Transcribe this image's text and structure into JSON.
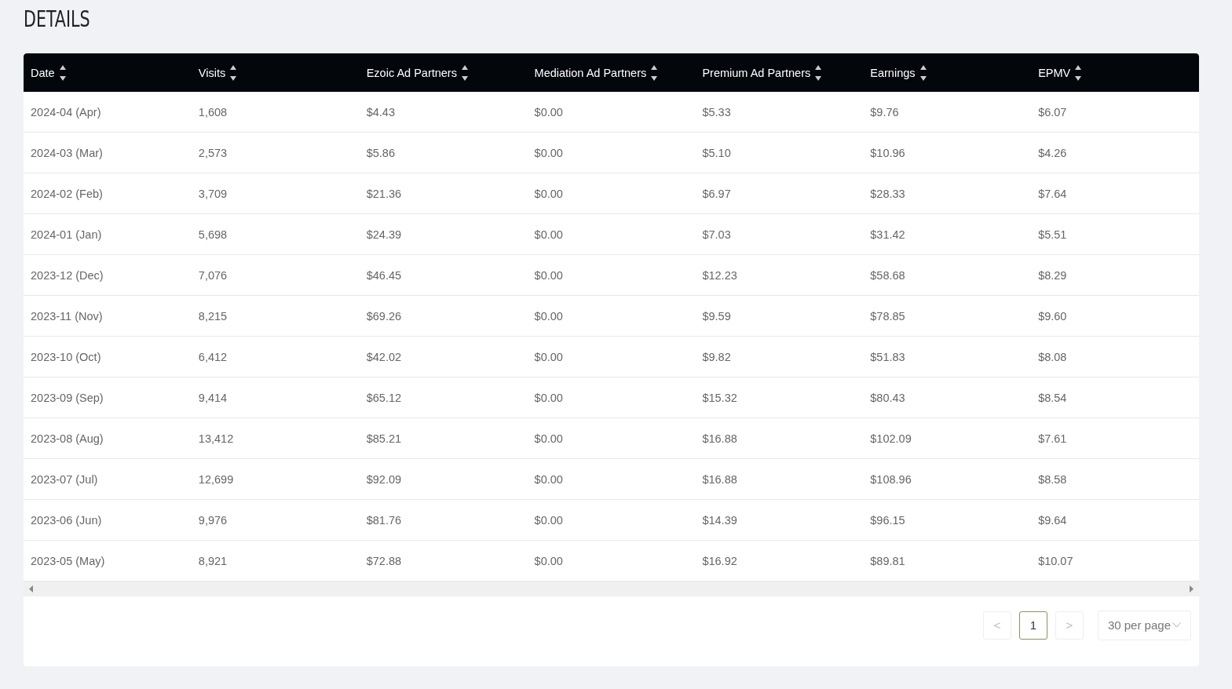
{
  "title": "DETAILS",
  "table": {
    "columns": [
      "Date",
      "Visits",
      "Ezoic Ad Partners",
      "Mediation Ad Partners",
      "Premium Ad Partners",
      "Earnings",
      "EPMV"
    ],
    "rows": [
      [
        "2024-04 (Apr)",
        "1,608",
        "$4.43",
        "$0.00",
        "$5.33",
        "$9.76",
        "$6.07"
      ],
      [
        "2024-03 (Mar)",
        "2,573",
        "$5.86",
        "$0.00",
        "$5.10",
        "$10.96",
        "$4.26"
      ],
      [
        "2024-02 (Feb)",
        "3,709",
        "$21.36",
        "$0.00",
        "$6.97",
        "$28.33",
        "$7.64"
      ],
      [
        "2024-01 (Jan)",
        "5,698",
        "$24.39",
        "$0.00",
        "$7.03",
        "$31.42",
        "$5.51"
      ],
      [
        "2023-12 (Dec)",
        "7,076",
        "$46.45",
        "$0.00",
        "$12.23",
        "$58.68",
        "$8.29"
      ],
      [
        "2023-11 (Nov)",
        "8,215",
        "$69.26",
        "$0.00",
        "$9.59",
        "$78.85",
        "$9.60"
      ],
      [
        "2023-10 (Oct)",
        "6,412",
        "$42.02",
        "$0.00",
        "$9.82",
        "$51.83",
        "$8.08"
      ],
      [
        "2023-09 (Sep)",
        "9,414",
        "$65.12",
        "$0.00",
        "$15.32",
        "$80.43",
        "$8.54"
      ],
      [
        "2023-08 (Aug)",
        "13,412",
        "$85.21",
        "$0.00",
        "$16.88",
        "$102.09",
        "$7.61"
      ],
      [
        "2023-07 (Jul)",
        "12,699",
        "$92.09",
        "$0.00",
        "$16.88",
        "$108.96",
        "$8.58"
      ],
      [
        "2023-06 (Jun)",
        "9,976",
        "$81.76",
        "$0.00",
        "$14.39",
        "$96.15",
        "$9.64"
      ],
      [
        "2023-05 (May)",
        "8,921",
        "$72.88",
        "$0.00",
        "$16.92",
        "$89.81",
        "$10.07"
      ]
    ]
  },
  "pagination": {
    "prev": "<",
    "pages": [
      {
        "label": "1",
        "selected": true
      }
    ],
    "next": ">",
    "page_size": "30 per page"
  }
}
